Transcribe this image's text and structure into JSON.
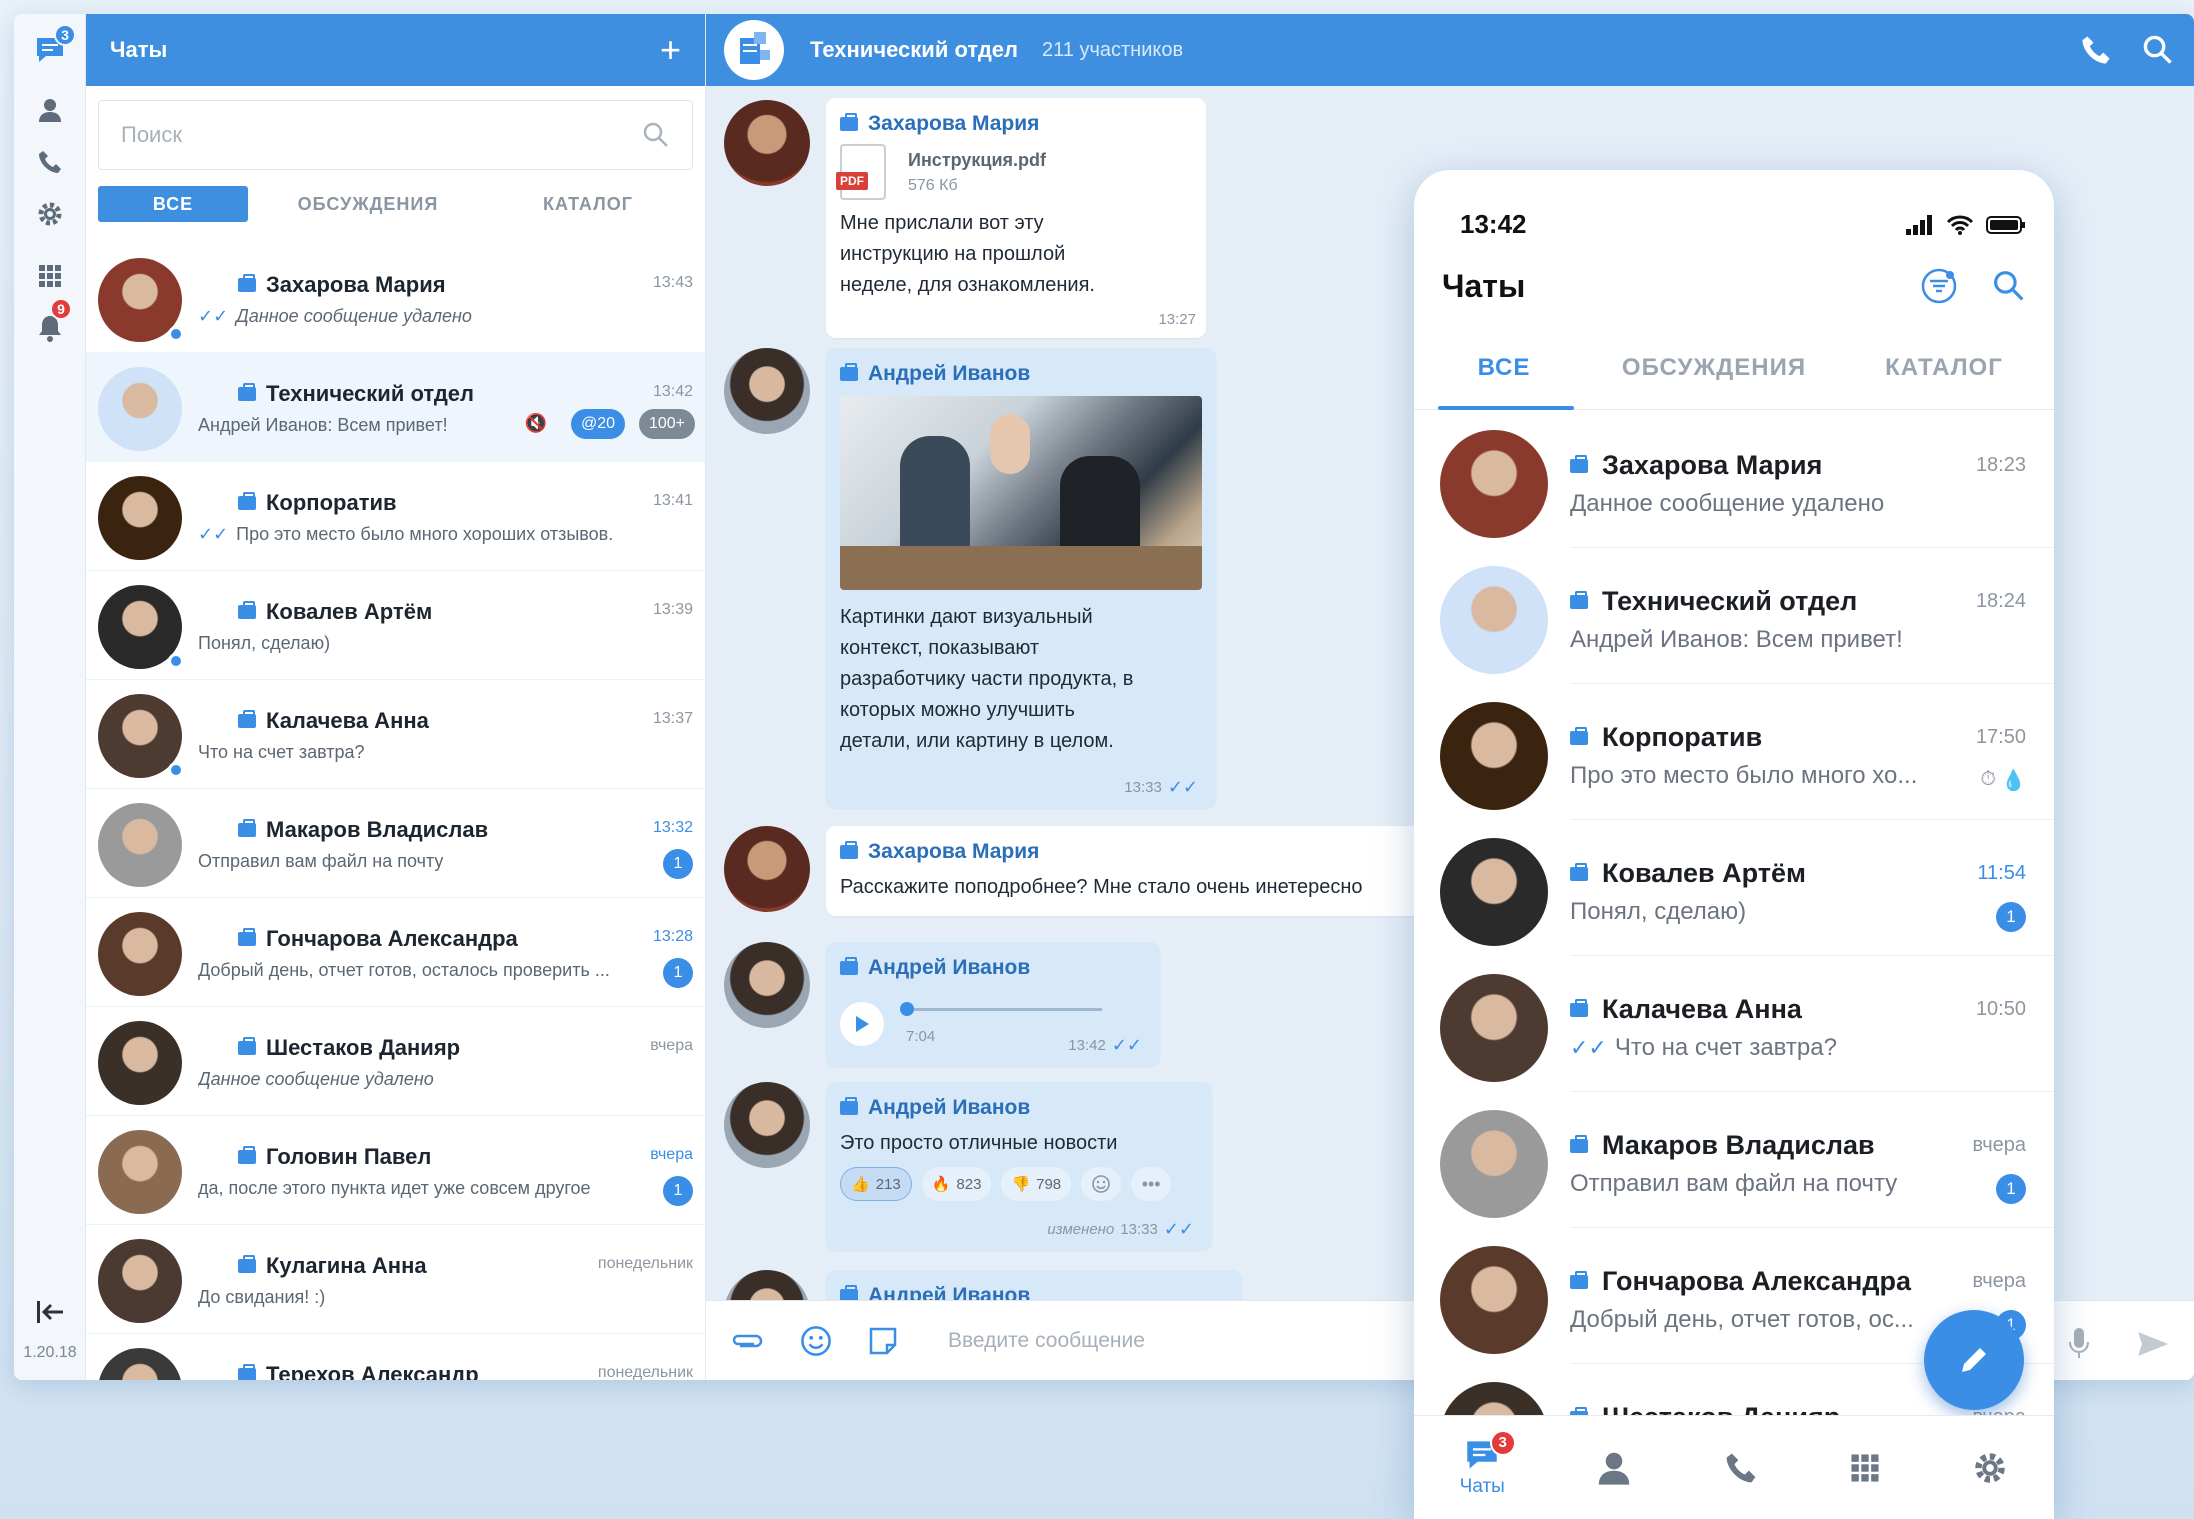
{
  "rail": {
    "chats_badge": "3",
    "notifications_badge": "9",
    "version": "1.20.18"
  },
  "list": {
    "title": "Чаты",
    "search_placeholder": "Поиск",
    "tabs": [
      "ВСЕ",
      "ОБСУЖДЕНИЯ",
      "КАТАЛОГ"
    ],
    "chats": [
      {
        "name": "Захарова Мария",
        "time": "13:43",
        "preview": "Данное сообщение удалено",
        "italic": true,
        "ticks": true,
        "avatar_color": "#8a3a2c"
      },
      {
        "name": "Технический отдел",
        "time": "13:42",
        "preview": "Андрей Иванов: Всем привет!",
        "mention": "@20",
        "count": "100+",
        "avatar_color": "#cfe2f7"
      },
      {
        "name": "Корпоратив",
        "time": "13:41",
        "preview": "Про это место было много хороших отзывов.",
        "ticks": true,
        "avatar_color": "#3a2410"
      },
      {
        "name": "Ковалев Артём",
        "time": "13:39",
        "preview": "Понял, сделаю)",
        "avatar_color": "#2a2a2a"
      },
      {
        "name": "Калачева Анна",
        "time": "13:37",
        "preview": "Что на счет завтра?",
        "avatar_color": "#4d3a30"
      },
      {
        "name": "Макаров Владислав",
        "time": "13:32",
        "preview": "Отправил вам файл на почту",
        "badge": "1",
        "avatar_color": "#9a9a9a"
      },
      {
        "name": "Гончарова Александра",
        "time": "13:28",
        "preview": "Добрый день, отчет готов, осталось проверить ...",
        "badge": "1",
        "avatar_color": "#5a3a2a"
      },
      {
        "name": "Шестаков Данияр",
        "time": "вчера",
        "preview": "Данное сообщение удалено",
        "italic": true,
        "avatar_color": "#3a3028"
      },
      {
        "name": "Головин Павел",
        "time": "вчера",
        "preview": "да, после этого пункта идет уже совсем другое",
        "badge": "1",
        "avatar_color": "#8a6a50"
      },
      {
        "name": "Кулагина Анна",
        "time": "понедельник",
        "preview": "До свидания! :)",
        "avatar_color": "#4a3a32"
      },
      {
        "name": "Терехов Александр",
        "time": "понедельник",
        "preview": "",
        "avatar_color": "#3a3a3a"
      }
    ]
  },
  "conversation": {
    "title": "Технический отдел",
    "members": "211 участников",
    "messages": [
      {
        "author": "Захарова Мария",
        "file_name": "Инструкция.pdf",
        "file_size": "576 Кб",
        "file_type": "PDF",
        "text": "Мне прислали вот эту инструкцию на прошлой неделе, для ознакомления.",
        "time": "13:27"
      },
      {
        "author": "Андрей Иванов",
        "text": "Картинки дают визуальный контекст, показывают разработчику части продукта, в которых можно улучшить детали, или картину в целом.",
        "time": "13:33"
      },
      {
        "author": "Захарова Мария",
        "text": "Расскажите поподробнее? Мне стало очень инетересно"
      },
      {
        "author": "Андрей Иванов",
        "voice_elapsed": "7:04",
        "time": "13:42",
        "progress": 0.0
      },
      {
        "author": "Андрей Иванов",
        "text": "Это просто отличные новости",
        "reactions": [
          {
            "icon": "👍",
            "count": "213"
          },
          {
            "icon": "🔥",
            "count": "823"
          },
          {
            "icon": "👎",
            "count": "798"
          }
        ],
        "edited": "изменено",
        "time": "13:33"
      },
      {
        "author": "Андрей Иванов"
      }
    ],
    "composer_placeholder": "Введите сообщение"
  },
  "phone": {
    "status_time": "13:42",
    "title": "Чаты",
    "tabs": [
      "ВСЕ",
      "ОБСУЖДЕНИЯ",
      "КАТАЛОГ"
    ],
    "chats": [
      {
        "name": "Захарова Мария",
        "time": "18:23",
        "preview": "Данное сообщение удалено"
      },
      {
        "name": "Технический отдел",
        "time": "18:24",
        "preview": "Андрей Иванов: Всем привет!"
      },
      {
        "name": "Корпоратив",
        "time": "17:50",
        "preview": "Про это место было много хо..."
      },
      {
        "name": "Ковалев Артём",
        "time": "11:54",
        "preview": "Понял, сделаю)",
        "badge": "1"
      },
      {
        "name": "Калачева Анна",
        "time": "10:50",
        "preview": "Что на счет завтра?"
      },
      {
        "name": "Макаров Владислав",
        "time": "вчера",
        "preview": "Отправил вам файл на почту",
        "badge": "1"
      },
      {
        "name": "Гончарова Александра",
        "time": "вчера",
        "preview": "Добрый день, отчет готов, ос...",
        "badge": "1"
      },
      {
        "name": "Шестаков Данияр",
        "time": "вчера",
        "preview": ""
      }
    ],
    "nav_label": "Чаты",
    "nav_badge": "3"
  },
  "colors": {
    "accent": "#3f8fe0",
    "badge": "#3a8ee6",
    "alert": "#e23b3b"
  }
}
